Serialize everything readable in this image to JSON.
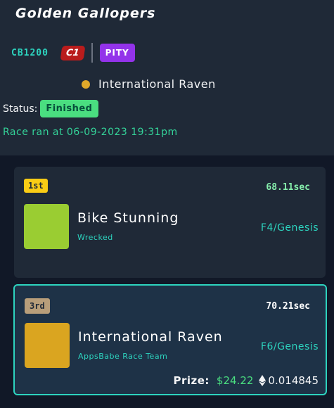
{
  "race": {
    "title": "Golden Gallopers",
    "class_code": "CB1200",
    "class_badge": "C1",
    "type_badge": "PITY",
    "horse_name": "International Raven",
    "horse_dot_color": "#e0a92a",
    "status_label": "Status:",
    "status_value": "Finished",
    "ran_at": "Race ran at 06-09-2023 19:31pm"
  },
  "results": [
    {
      "position": "1st",
      "time": "68.11sec",
      "horse": "Bike Stunning",
      "team": "Wrecked",
      "rank": "F4/Genesis",
      "color": "#9acd32"
    },
    {
      "position": "3rd",
      "time": "70.21sec",
      "horse": "International Raven",
      "team": "AppsBabe Race Team",
      "rank": "F6/Genesis",
      "color": "#daa520",
      "prize_label": "Prize:",
      "prize_usd": "$24.22",
      "prize_eth": "0.014845",
      "eth_icon": "ethereum-icon"
    }
  ]
}
